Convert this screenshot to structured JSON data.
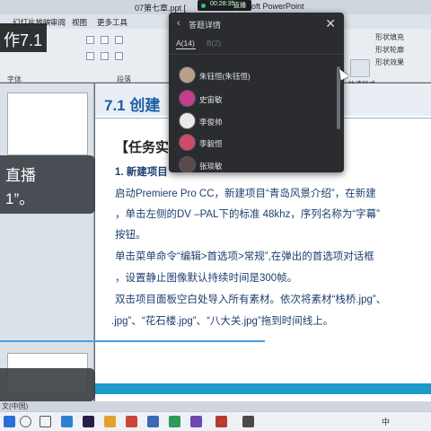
{
  "window": {
    "doc_title": "07第七章.ppt [",
    "app_title": "oft PowerPoint",
    "recording_time": "00:28:35",
    "recording_status": "直播中"
  },
  "ribbon": {
    "tabs": [
      "幻灯片放映",
      "审阅",
      "视图",
      "更多工具"
    ],
    "groups": [
      "字体",
      "段落"
    ],
    "items": [
      "形状填充",
      "形状轮廓",
      "形状效果",
      "快速样式"
    ]
  },
  "captions": {
    "top": "作7.1",
    "mid_line1": "直播",
    "mid_line2": "1”。"
  },
  "slide": {
    "title": "7.1 创建",
    "section": "【任务实",
    "step": "1. 新建项目",
    "paragraphs": [
      "启动Premiere Pro CC，新建项目“青岛风景介绍”，在新建",
      "，单击左侧的DV –PAL下的标准 48khz，序列名称为“字幕”",
      "按钮。",
      "单击菜单命令“编辑>首选项>常规”,在弹出的首选项对话框",
      "，设置静止图像默认持续时间是300帧。",
      "双击项目面板空白处导入所有素材。依次将素材“栈桥.jpg”、",
      ".jpg”、“花石楼.jpg”、“八大关.jpg”拖到时间线上。"
    ]
  },
  "statusbar": {
    "text": "文(中国)"
  },
  "popup": {
    "title": "答题详情",
    "tab_answered": "A(14)",
    "tab_other": "B(2)",
    "users": [
      {
        "name": "朱钰恒(朱钰恒)",
        "avatar_color": "#b9a08a"
      },
      {
        "name": "史宙敏",
        "avatar_color": "#c43c8e"
      },
      {
        "name": "李俊帅",
        "avatar_color": "#e9e9e9"
      },
      {
        "name": "李毅恒",
        "avatar_color": "#d04a6a"
      },
      {
        "name": "张琰敏",
        "avatar_color": "#5a4a4a"
      }
    ]
  },
  "taskbar": {
    "icons": [
      "windows-icon",
      "search-icon",
      "taskview-icon",
      "explorer-icon",
      "edge-icon",
      "ie-icon",
      "store-icon",
      "mail-icon",
      "premiere-icon",
      "chrome-icon",
      "powerpoint-icon",
      "word-icon"
    ],
    "tray_text": "中"
  },
  "colors": {
    "accent_blue": "#1b5ea8",
    "footer_band": "#1a9bc9",
    "popup_bg": "#2a2c30"
  }
}
